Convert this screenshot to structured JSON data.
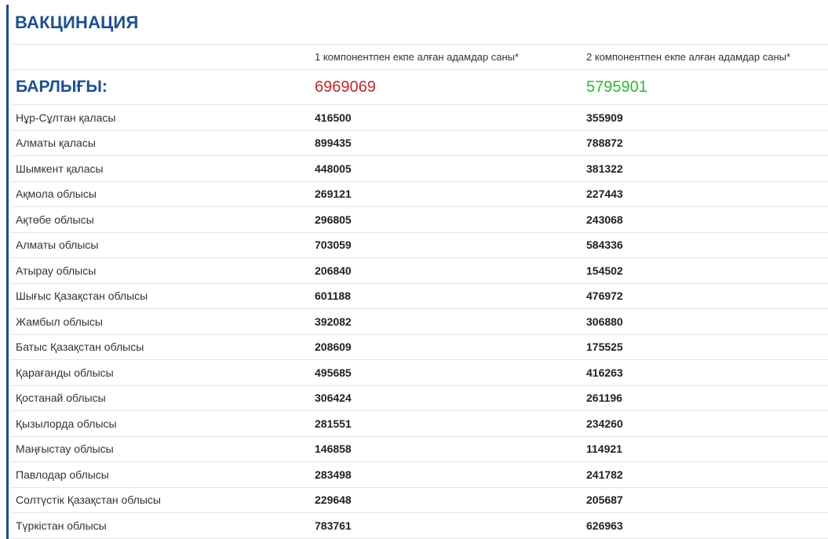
{
  "title": "ВАКЦИНАЦИЯ",
  "columns": {
    "dose1": "1 компонентпен екпе алған адамдар саны*",
    "dose2": "2 компонентпен екпе алған адамдар саны*"
  },
  "total": {
    "label": "БАРЛЫҒЫ:",
    "dose1": "6969069",
    "dose2": "5795901"
  },
  "colors": {
    "accent": "#1f4f8f",
    "total_dose1": "#c0282d",
    "total_dose2": "#2fb82f"
  },
  "rows": [
    {
      "region": "Нұр-Сұлтан қаласы",
      "dose1": "416500",
      "dose2": "355909"
    },
    {
      "region": "Алматы қаласы",
      "dose1": "899435",
      "dose2": "788872"
    },
    {
      "region": "Шымкент қаласы",
      "dose1": "448005",
      "dose2": "381322"
    },
    {
      "region": "Ақмола облысы",
      "dose1": "269121",
      "dose2": "227443"
    },
    {
      "region": "Ақтөбе облысы",
      "dose1": "296805",
      "dose2": "243068"
    },
    {
      "region": "Алматы облысы",
      "dose1": "703059",
      "dose2": "584336"
    },
    {
      "region": "Атырау облысы",
      "dose1": "206840",
      "dose2": "154502"
    },
    {
      "region": "Шығыс Қазақстан облысы",
      "dose1": "601188",
      "dose2": "476972"
    },
    {
      "region": "Жамбыл облысы",
      "dose1": "392082",
      "dose2": "306880"
    },
    {
      "region": "Батыс Қазақстан облысы",
      "dose1": "208609",
      "dose2": "175525"
    },
    {
      "region": "Қарағанды облысы",
      "dose1": "495685",
      "dose2": "416263"
    },
    {
      "region": "Қостанай облысы",
      "dose1": "306424",
      "dose2": "261196"
    },
    {
      "region": "Қызылорда облысы",
      "dose1": "281551",
      "dose2": "234260"
    },
    {
      "region": "Маңғыстау облысы",
      "dose1": "146858",
      "dose2": "114921"
    },
    {
      "region": "Павлодар облысы",
      "dose1": "283498",
      "dose2": "241782"
    },
    {
      "region": "Солтүстік Қазақстан облысы",
      "dose1": "229648",
      "dose2": "205687"
    },
    {
      "region": "Түркістан облысы",
      "dose1": "783761",
      "dose2": "626963"
    }
  ]
}
